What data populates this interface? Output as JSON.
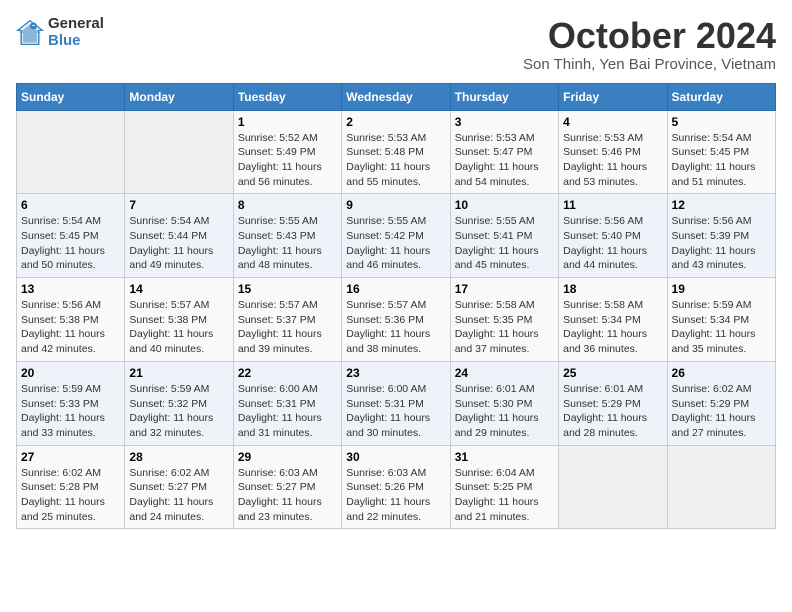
{
  "logo": {
    "general": "General",
    "blue": "Blue"
  },
  "title": "October 2024",
  "location": "Son Thinh, Yen Bai Province, Vietnam",
  "header": {
    "days": [
      "Sunday",
      "Monday",
      "Tuesday",
      "Wednesday",
      "Thursday",
      "Friday",
      "Saturday"
    ]
  },
  "weeks": [
    [
      {
        "day": "",
        "content": ""
      },
      {
        "day": "",
        "content": ""
      },
      {
        "day": "1",
        "content": "Sunrise: 5:52 AM\nSunset: 5:49 PM\nDaylight: 11 hours and 56 minutes."
      },
      {
        "day": "2",
        "content": "Sunrise: 5:53 AM\nSunset: 5:48 PM\nDaylight: 11 hours and 55 minutes."
      },
      {
        "day": "3",
        "content": "Sunrise: 5:53 AM\nSunset: 5:47 PM\nDaylight: 11 hours and 54 minutes."
      },
      {
        "day": "4",
        "content": "Sunrise: 5:53 AM\nSunset: 5:46 PM\nDaylight: 11 hours and 53 minutes."
      },
      {
        "day": "5",
        "content": "Sunrise: 5:54 AM\nSunset: 5:45 PM\nDaylight: 11 hours and 51 minutes."
      }
    ],
    [
      {
        "day": "6",
        "content": "Sunrise: 5:54 AM\nSunset: 5:45 PM\nDaylight: 11 hours and 50 minutes."
      },
      {
        "day": "7",
        "content": "Sunrise: 5:54 AM\nSunset: 5:44 PM\nDaylight: 11 hours and 49 minutes."
      },
      {
        "day": "8",
        "content": "Sunrise: 5:55 AM\nSunset: 5:43 PM\nDaylight: 11 hours and 48 minutes."
      },
      {
        "day": "9",
        "content": "Sunrise: 5:55 AM\nSunset: 5:42 PM\nDaylight: 11 hours and 46 minutes."
      },
      {
        "day": "10",
        "content": "Sunrise: 5:55 AM\nSunset: 5:41 PM\nDaylight: 11 hours and 45 minutes."
      },
      {
        "day": "11",
        "content": "Sunrise: 5:56 AM\nSunset: 5:40 PM\nDaylight: 11 hours and 44 minutes."
      },
      {
        "day": "12",
        "content": "Sunrise: 5:56 AM\nSunset: 5:39 PM\nDaylight: 11 hours and 43 minutes."
      }
    ],
    [
      {
        "day": "13",
        "content": "Sunrise: 5:56 AM\nSunset: 5:38 PM\nDaylight: 11 hours and 42 minutes."
      },
      {
        "day": "14",
        "content": "Sunrise: 5:57 AM\nSunset: 5:38 PM\nDaylight: 11 hours and 40 minutes."
      },
      {
        "day": "15",
        "content": "Sunrise: 5:57 AM\nSunset: 5:37 PM\nDaylight: 11 hours and 39 minutes."
      },
      {
        "day": "16",
        "content": "Sunrise: 5:57 AM\nSunset: 5:36 PM\nDaylight: 11 hours and 38 minutes."
      },
      {
        "day": "17",
        "content": "Sunrise: 5:58 AM\nSunset: 5:35 PM\nDaylight: 11 hours and 37 minutes."
      },
      {
        "day": "18",
        "content": "Sunrise: 5:58 AM\nSunset: 5:34 PM\nDaylight: 11 hours and 36 minutes."
      },
      {
        "day": "19",
        "content": "Sunrise: 5:59 AM\nSunset: 5:34 PM\nDaylight: 11 hours and 35 minutes."
      }
    ],
    [
      {
        "day": "20",
        "content": "Sunrise: 5:59 AM\nSunset: 5:33 PM\nDaylight: 11 hours and 33 minutes."
      },
      {
        "day": "21",
        "content": "Sunrise: 5:59 AM\nSunset: 5:32 PM\nDaylight: 11 hours and 32 minutes."
      },
      {
        "day": "22",
        "content": "Sunrise: 6:00 AM\nSunset: 5:31 PM\nDaylight: 11 hours and 31 minutes."
      },
      {
        "day": "23",
        "content": "Sunrise: 6:00 AM\nSunset: 5:31 PM\nDaylight: 11 hours and 30 minutes."
      },
      {
        "day": "24",
        "content": "Sunrise: 6:01 AM\nSunset: 5:30 PM\nDaylight: 11 hours and 29 minutes."
      },
      {
        "day": "25",
        "content": "Sunrise: 6:01 AM\nSunset: 5:29 PM\nDaylight: 11 hours and 28 minutes."
      },
      {
        "day": "26",
        "content": "Sunrise: 6:02 AM\nSunset: 5:29 PM\nDaylight: 11 hours and 27 minutes."
      }
    ],
    [
      {
        "day": "27",
        "content": "Sunrise: 6:02 AM\nSunset: 5:28 PM\nDaylight: 11 hours and 25 minutes."
      },
      {
        "day": "28",
        "content": "Sunrise: 6:02 AM\nSunset: 5:27 PM\nDaylight: 11 hours and 24 minutes."
      },
      {
        "day": "29",
        "content": "Sunrise: 6:03 AM\nSunset: 5:27 PM\nDaylight: 11 hours and 23 minutes."
      },
      {
        "day": "30",
        "content": "Sunrise: 6:03 AM\nSunset: 5:26 PM\nDaylight: 11 hours and 22 minutes."
      },
      {
        "day": "31",
        "content": "Sunrise: 6:04 AM\nSunset: 5:25 PM\nDaylight: 11 hours and 21 minutes."
      },
      {
        "day": "",
        "content": ""
      },
      {
        "day": "",
        "content": ""
      }
    ]
  ]
}
